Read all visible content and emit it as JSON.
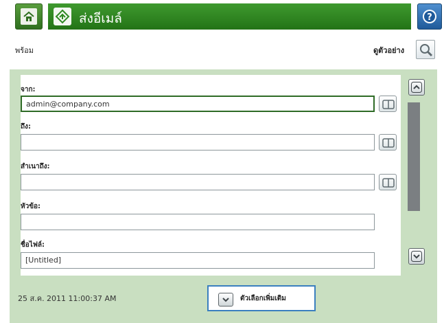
{
  "header": {
    "title": "ส่งอีเมล์",
    "home_icon": "home-icon",
    "app_icon": "email-send-icon",
    "help_icon": "help-icon"
  },
  "status": {
    "text": "พร้อม",
    "preview_label": "ดูตัวอย่าง",
    "preview_icon": "magnifier-icon"
  },
  "form": {
    "from_label": "จาก:",
    "from_value": "admin@company.com",
    "to_label": "ถึง:",
    "to_value": "",
    "cc_label": "สำเนาถึง:",
    "cc_value": "",
    "subject_label": "หัวข้อ:",
    "subject_value": "",
    "filename_label": "ชื่อไฟล์:",
    "filename_value": "[Untitled]",
    "address_book_icon": "address-book-icon"
  },
  "footer": {
    "datetime": "25 ส.ค. 2011 11:00:37 AM",
    "more_options_label": "ตัวเลือกเพิ่มเติม"
  },
  "colors": {
    "title_green": "#2f8a23",
    "panel_green": "#c9dfc1",
    "active_border": "#2e6b26",
    "help_blue": "#1f5a9a",
    "more_border": "#3a7fbf"
  }
}
